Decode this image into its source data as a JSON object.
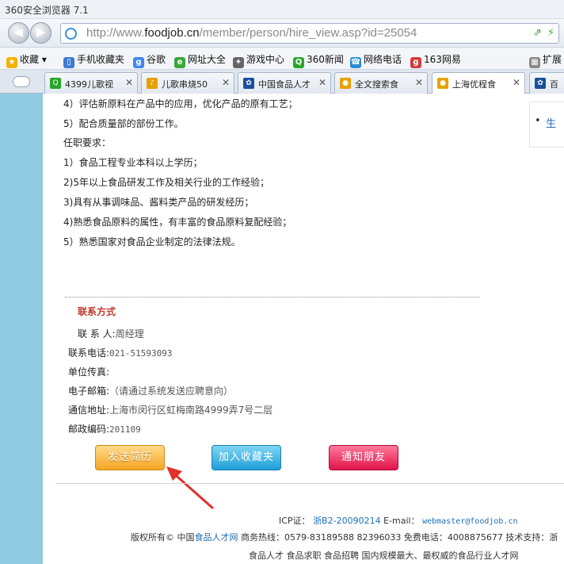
{
  "browser": {
    "title": "360安全浏览器 7.1",
    "url_prefix": "http://www.",
    "url_domain": "foodjob.cn",
    "url_path": "/member/person/hire_view.asp?id=25054",
    "back_icon": "back-arrow-icon",
    "forward_icon": "forward-arrow-icon"
  },
  "favorites": [
    {
      "label": "收藏",
      "icon": "star-icon",
      "color": "#f0b400"
    },
    {
      "label": "手机收藏夹",
      "icon": "phone-icon",
      "color": "#3a7bd5"
    },
    {
      "label": "谷歌",
      "icon": "google-icon",
      "color": "#4285f4"
    },
    {
      "label": "网址大全",
      "icon": "globe-icon",
      "color": "#3aa83a"
    },
    {
      "label": "游戏中心",
      "icon": "gamepad-icon",
      "color": "#666666"
    },
    {
      "label": "360新闻",
      "icon": "search-icon",
      "color": "#2aa52a"
    },
    {
      "label": "网络电话",
      "icon": "phone-icon",
      "color": "#2a8ad6"
    },
    {
      "label": "163网易",
      "icon": "netease-icon",
      "color": "#d23c3c"
    },
    {
      "label": "扩展",
      "icon": "grid-icon",
      "color": "#888888"
    }
  ],
  "tabs": [
    {
      "label": "4399儿歌视",
      "color": "#2aa52a"
    },
    {
      "label": "儿歌串烧50",
      "color": "#e6a100"
    },
    {
      "label": "中国食品人才",
      "color": "#1b4f9c"
    },
    {
      "label": "全文搜索食",
      "color": "#e6a100"
    },
    {
      "label": "上海优程食",
      "color": "#e6a100"
    },
    {
      "label": "百",
      "color": "#1b4f9c"
    }
  ],
  "duties": [
    "4）评估新原料在产品中的应用，优化产品的原有工艺；",
    "5）配合质量部的部份工作。",
    "任职要求：",
    "1）食品工程专业本科以上学历；",
    "2)5年以上食品研发工作及相关行业的工作经验；",
    "3)具有从事调味品、酱料类产品的研发经历；",
    "4)熟悉食品原料的属性，有丰富的食品原料复配经验；",
    "5）熟悉国家对食品企业制定的法律法规。"
  ],
  "right_panel": {
    "bullet": "•",
    "text": "生"
  },
  "contact": {
    "title": "联系方式",
    "person_label": "联 系 人:",
    "person_value": "周经理",
    "phone_label": "联系电话:",
    "phone_value": "021-51593093",
    "fax_label": "单位传真:",
    "fax_value": "",
    "email_label": "电子邮箱:",
    "email_value": "（请通过系统发送应聘意向）",
    "address_label": "通信地址:",
    "address_value": "上海市闵行区虹梅南路4999弄7号二层",
    "postcode_label": "邮政编码:",
    "postcode_value": "201109"
  },
  "actions": {
    "send_resume": "发送简历",
    "add_favorite": "加入收藏夹",
    "notify_friend": "通知朋友"
  },
  "footer": {
    "icp_label": "ICP证：",
    "icp_value": "浙B2-20090214",
    "email_label": "E-mail：",
    "email_value": "webmaster@foodjob.cn",
    "copyright_prefix": "版权所有© 中国",
    "copyright_link": "食品人才网",
    "hotline": " 商务热线：0579-83189588 82396033 免费电话：4008875677 技术支持：浙",
    "tagline": "食品人才 食品求职 食品招聘 国内规模最大、最权威的食品行业人才网"
  },
  "colors": {
    "accent_red": "#c0392b",
    "link_blue": "#1d6eb8",
    "gutter": "#8fcbe1"
  }
}
